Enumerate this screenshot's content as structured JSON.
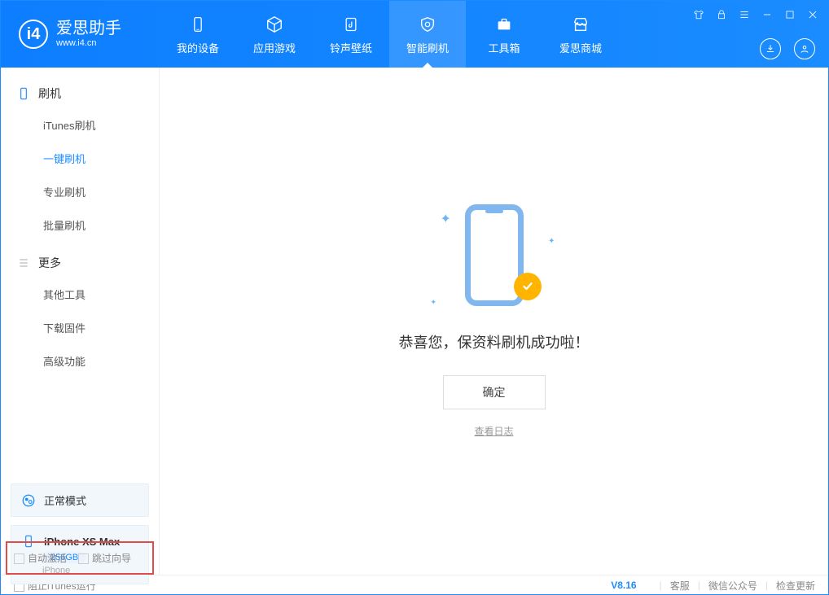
{
  "app": {
    "name": "爱思助手",
    "domain": "www.i4.cn"
  },
  "header_tabs": [
    {
      "label": "我的设备"
    },
    {
      "label": "应用游戏"
    },
    {
      "label": "铃声壁纸"
    },
    {
      "label": "智能刷机"
    },
    {
      "label": "工具箱"
    },
    {
      "label": "爱思商城"
    }
  ],
  "sidebar": {
    "section1": "刷机",
    "items": [
      "iTunes刷机",
      "一键刷机",
      "专业刷机",
      "批量刷机"
    ],
    "section2": "更多",
    "items2": [
      "其他工具",
      "下载固件",
      "高级功能"
    ]
  },
  "device": {
    "mode": "正常模式",
    "name": "iPhone XS Max",
    "storage": "256GB",
    "type": "iPhone"
  },
  "options": {
    "auto_activate": "自动激活",
    "skip_guide": "跳过向导"
  },
  "main": {
    "message": "恭喜您，保资料刷机成功啦！",
    "ok": "确定",
    "view_log": "查看日志"
  },
  "footer": {
    "block_itunes": "阻止iTunes运行",
    "version": "V8.16",
    "support": "客服",
    "wechat": "微信公众号",
    "check_update": "检查更新"
  }
}
